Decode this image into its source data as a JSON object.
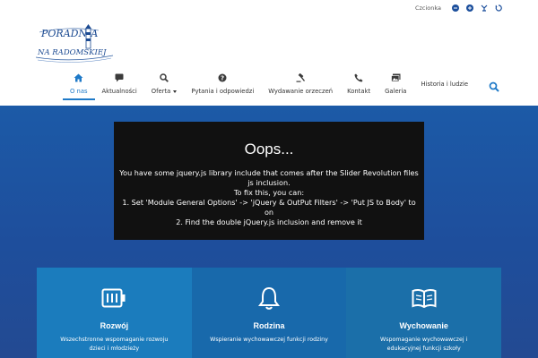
{
  "topbar": {
    "font_label": "Czcionka",
    "controls": [
      "decrease-font-icon",
      "increase-font-icon",
      "contrast-icon",
      "reset-icon"
    ]
  },
  "logo": {
    "line1": "PORADNIA",
    "line2": "NA RADOMSKIEJ"
  },
  "nav": {
    "items": [
      {
        "label": "O nas",
        "icon": "home-icon",
        "active": true
      },
      {
        "label": "Aktualności",
        "icon": "comment-icon"
      },
      {
        "label": "Oferta",
        "icon": "search-icon",
        "has_dropdown": true
      },
      {
        "label": "Pytania i odpowiedzi",
        "icon": "question-icon"
      },
      {
        "label": "Wydawanie orzeczeń",
        "icon": "gavel-icon"
      },
      {
        "label": "Kontakt",
        "icon": "phone-icon"
      },
      {
        "label": "Galeria",
        "icon": "images-icon"
      },
      {
        "label": "Historia i ludzie",
        "icon": ""
      }
    ],
    "search_icon": "search-icon"
  },
  "hero": {
    "error_title": "Oops...",
    "error_lines": [
      "You have some jquery.js library include that comes after the Slider Revolution files js inclusion.",
      "To fix this, you can:",
      "1. Set 'Module General Options' -> 'jQuery & OutPut Filters' -> 'Put JS to Body' to on",
      "2. Find the double jQuery.js inclusion and remove it"
    ]
  },
  "features": [
    {
      "title": "Rozwój",
      "desc": "Wszechstronne wspomaganie rozwoju dzieci i młodzieży",
      "icon": "battery-icon"
    },
    {
      "title": "Rodzina",
      "desc": "Wspieranie wychowawczej funkcji rodziny",
      "icon": "bell-icon"
    },
    {
      "title": "Wychowanie",
      "desc": "Wspomaganie wychowawczej i edukacyjnej funkcji szkoły",
      "icon": "book-icon"
    }
  ],
  "colors": {
    "accent": "#1f7ac8",
    "hero_bg": "#1e4e9c",
    "error_bg": "#111111",
    "box1": "#1b7cbd",
    "box2": "#1869ab",
    "box3": "#1b6fa9"
  }
}
